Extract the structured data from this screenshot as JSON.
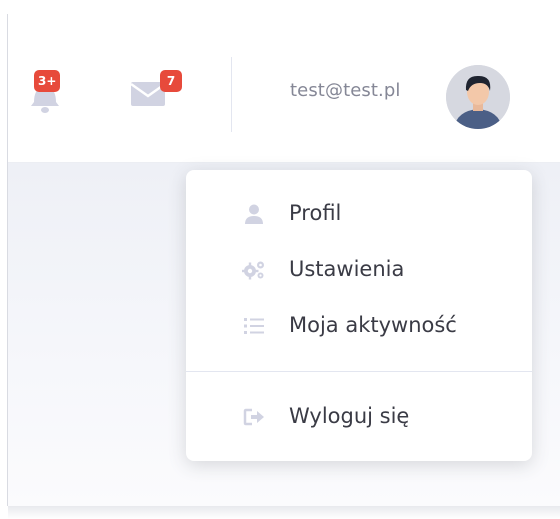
{
  "topbar": {
    "alerts": {
      "badge": "3+"
    },
    "messages": {
      "badge": "7"
    },
    "user": {
      "name": "test@test.pl"
    }
  },
  "dropdown": {
    "items": [
      {
        "label": "Profil",
        "icon": "user-icon"
      },
      {
        "label": "Ustawienia",
        "icon": "cogs-icon"
      },
      {
        "label": "Moja aktywność",
        "icon": "list-icon"
      },
      {
        "label": "Wyloguj się",
        "icon": "sign-out-icon"
      }
    ]
  },
  "colors": {
    "badge": "#e74a3b",
    "icon_muted": "#d1d3e2",
    "text_muted": "#858796",
    "text_dark": "#3a3b45"
  }
}
